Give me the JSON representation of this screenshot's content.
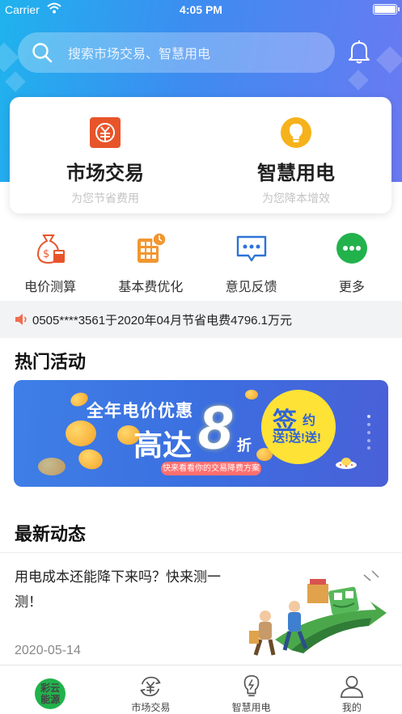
{
  "status_bar": {
    "carrier": "Carrier",
    "time": "4:05 PM"
  },
  "search": {
    "placeholder": "搜索市场交易、智慧用电",
    "icon": "search-icon"
  },
  "feature_cards": [
    {
      "title": "市场交易",
      "subtitle": "为您节省费用",
      "icon": "yuan-exchange-icon",
      "color": "#e8542a"
    },
    {
      "title": "智慧用电",
      "subtitle": "为您降本增效",
      "icon": "lightbulb-icon",
      "color": "#f6b21b"
    }
  ],
  "quick_actions": [
    {
      "label": "电价测算",
      "icon": "money-bag-calculator-icon"
    },
    {
      "label": "基本费优化",
      "icon": "calculator-clock-icon"
    },
    {
      "label": "意见反馈",
      "icon": "chat-bubble-icon"
    },
    {
      "label": "更多",
      "icon": "more-icon"
    }
  ],
  "notice": {
    "text": "0505****3561于2020年04月节省电费4796.1万元",
    "icon": "speaker-icon"
  },
  "hot_activities": {
    "title": "热门活动",
    "banner": {
      "line1": "全年电价优惠",
      "line2": "高达",
      "big": "8",
      "unit": "折",
      "badge_main": "签",
      "badge_side": "约",
      "badge_sub": "送!送!送!",
      "pill": "快来看看你的交易降费方案"
    }
  },
  "latest_news": {
    "title": "最新动态",
    "items": [
      {
        "headline": "用电成本还能降下来吗？快来测一测！",
        "date": "2020-05-14"
      }
    ]
  },
  "tab_bar": {
    "home_logo_line1": "彩云",
    "home_logo_line2": "能源",
    "tabs": [
      {
        "label": "市场交易",
        "icon": "yuan-cycle-icon"
      },
      {
        "label": "智慧用电",
        "icon": "lightbulb-outline-icon"
      },
      {
        "label": "我的",
        "icon": "user-icon"
      }
    ]
  },
  "colors": {
    "accent": "#3d8cf0",
    "brand_green": "#22b24c",
    "orange": "#e8542a"
  }
}
